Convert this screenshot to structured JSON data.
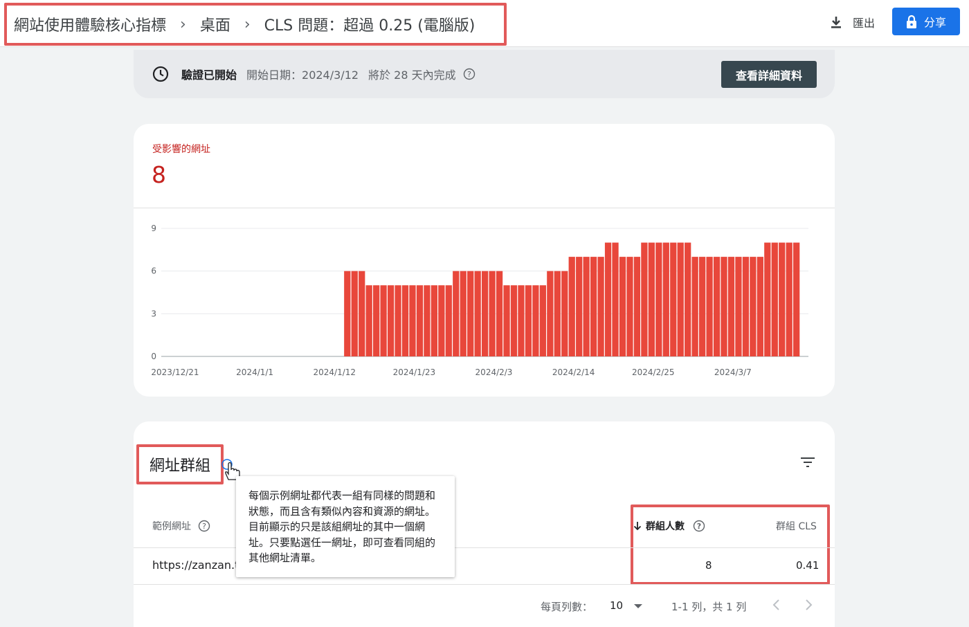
{
  "header": {
    "breadcrumb": [
      "網站使用體驗核心指標",
      "桌面",
      "CLS 問題：超過 0.25 (電腦版)"
    ],
    "breadcrumb_separator": "›",
    "export_label": "匯出",
    "share_label": "分享",
    "export_icon": "download-icon",
    "share_icon": "lock-icon",
    "accent_color": "#1a73e8"
  },
  "validation": {
    "icon": "clock-icon",
    "title": "驗證已開始",
    "start_date": "開始日期：2024/3/12",
    "completion": "將於 28 天內完成",
    "details_button": "查看詳細資料"
  },
  "metric": {
    "label": "受影響的網址",
    "value": "8",
    "color": "#c5221f"
  },
  "chart_data": {
    "type": "bar",
    "x_ticks": [
      "2023/12/21",
      "2024/1/1",
      "2024/1/12",
      "2024/1/23",
      "2024/2/3",
      "2024/2/14",
      "2024/2/25",
      "2024/3/7"
    ],
    "y_ticks": [
      0,
      3,
      6,
      9
    ],
    "ylim": [
      0,
      9
    ],
    "grid": true,
    "bar_color": "#e8473b",
    "series": [
      {
        "values": [
          0,
          0,
          0,
          0,
          0,
          0,
          0,
          0,
          0,
          0,
          0,
          0,
          0,
          0,
          0,
          0,
          0,
          0,
          0,
          0,
          0,
          0,
          0,
          0,
          0,
          6,
          6,
          6,
          5,
          5,
          5,
          5,
          5,
          5,
          5,
          5,
          5,
          5,
          5,
          5,
          6,
          6,
          6,
          6,
          6,
          6,
          6,
          5,
          5,
          5,
          5,
          5,
          5,
          6,
          6,
          6,
          7,
          7,
          7,
          7,
          7,
          8,
          8,
          7,
          7,
          7,
          8,
          8,
          8,
          8,
          8,
          8,
          8,
          7,
          7,
          7,
          7,
          7,
          7,
          7,
          7,
          7,
          7,
          8,
          8,
          8,
          8,
          8
        ]
      }
    ]
  },
  "table": {
    "title": "網址群組",
    "filter_icon": "filter-icon",
    "columns": {
      "url": "範例網址",
      "count": "群組人數",
      "cls": "群組 CLS"
    },
    "rows": [
      {
        "url": "https://zanzan.tw",
        "count": "8",
        "cls": "0.41"
      }
    ],
    "pagination": {
      "rows_per_page_label": "每頁列數：",
      "rows_per_page": "10",
      "range": "1-1 列，共 1 列"
    }
  },
  "tooltip": {
    "text": "每個示例網址都代表一組有同樣的問題和狀態，而且含有類似內容和資源的網址。目前顯示的只是該組網址的其中一個網址。只要點選任一網址，即可查看同組的其他網址清單。"
  }
}
